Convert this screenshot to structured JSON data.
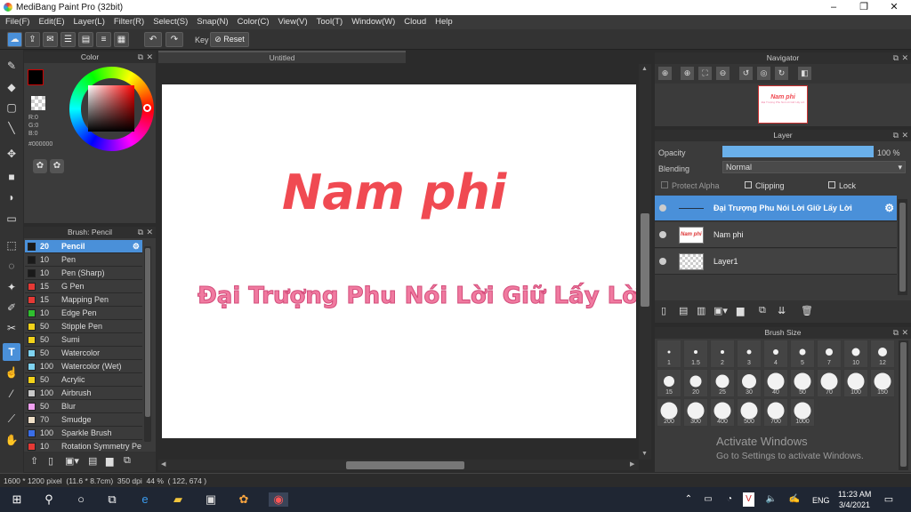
{
  "window": {
    "title": "MediBang Paint Pro (32bit)",
    "min": "–",
    "max": "❐",
    "close": "✕"
  },
  "menu": [
    "File(F)",
    "Edit(E)",
    "Layer(L)",
    "Filter(R)",
    "Select(S)",
    "Snap(N)",
    "Color(C)",
    "View(V)",
    "Tool(T)",
    "Window(W)",
    "Cloud",
    "Help"
  ],
  "toolbar": {
    "key_label": "Key",
    "reset_label": "Reset"
  },
  "color_panel": {
    "title": "Color",
    "r": "R:0",
    "g": "G:0",
    "b": "B:0",
    "hex": "#000000"
  },
  "brush_panel": {
    "title": "Brush: Pencil",
    "items": [
      {
        "size": "20",
        "name": "Pencil",
        "color": "#1a1a1a",
        "selected": true
      },
      {
        "size": "10",
        "name": "Pen",
        "color": "#1a1a1a"
      },
      {
        "size": "10",
        "name": "Pen (Sharp)",
        "color": "#1a1a1a"
      },
      {
        "size": "15",
        "name": "G Pen",
        "color": "#e53935"
      },
      {
        "size": "15",
        "name": "Mapping Pen",
        "color": "#e53935"
      },
      {
        "size": "10",
        "name": "Edge Pen",
        "color": "#2fbf2f"
      },
      {
        "size": "50",
        "name": "Stipple Pen",
        "color": "#f2d21a"
      },
      {
        "size": "50",
        "name": "Sumi",
        "color": "#f2d21a"
      },
      {
        "size": "50",
        "name": "Watercolor",
        "color": "#7fd3f0"
      },
      {
        "size": "100",
        "name": "Watercolor (Wet)",
        "color": "#7fd3f0"
      },
      {
        "size": "50",
        "name": "Acrylic",
        "color": "#f2d21a"
      },
      {
        "size": "100",
        "name": "Airbrush",
        "color": "#c8c8c8"
      },
      {
        "size": "50",
        "name": "Blur",
        "color": "#f0a0f0"
      },
      {
        "size": "70",
        "name": "Smudge",
        "color": "#f0e0c8"
      },
      {
        "size": "100",
        "name": "Sparkle Brush",
        "color": "#3a6ee8"
      },
      {
        "size": "10",
        "name": "Rotation Symmetry Pe",
        "color": "#e53935"
      }
    ]
  },
  "canvas": {
    "tab_title": "Untitled",
    "heading": "Nam phi",
    "subtext": "Đại Trượng Phu Nói Lời Giữ Lấy Lời",
    "heading_color": "#f04a52",
    "subtext_color": "#f07aa0"
  },
  "navigator": {
    "title": "Navigator",
    "thumb_heading": "Nam phi",
    "thumb_sub": "Đại Trượng Phu Nói Lời Giữ Lấy Lời"
  },
  "layer_panel": {
    "title": "Layer",
    "opacity_label": "Opacity",
    "opacity_value": "100 %",
    "blending_label": "Blending",
    "blending_value": "Normal",
    "protect_alpha": "Protect Alpha",
    "clipping": "Clipping",
    "lock": "Lock",
    "layers": [
      {
        "name": "Đại Trượng Phu Nói Lời Giữ Lấy Lời",
        "selected": true
      },
      {
        "name": "Nam phi",
        "thumb_text": "Nam phi"
      },
      {
        "name": "Layer1"
      }
    ]
  },
  "brush_size_panel": {
    "title": "Brush Size",
    "sizes": [
      "1",
      "1.5",
      "2",
      "3",
      "4",
      "5",
      "7",
      "10",
      "12",
      "15",
      "20",
      "25",
      "30",
      "40",
      "50",
      "70",
      "100",
      "150",
      "200",
      "300",
      "400",
      "500",
      "700",
      "1000"
    ]
  },
  "status": {
    "text": "1600 * 1200 pixel  (11.6 * 8.7cm)  350 dpi  44 %  ( 122, 674 )"
  },
  "watermark": {
    "line1": "Activate Windows",
    "line2": "Go to Settings to activate Windows."
  },
  "taskbar": {
    "lang": "ENG",
    "time": "11:23 AM",
    "date": "3/4/2021"
  },
  "colors": {
    "accent": "#4a90d9",
    "panel_bg": "#3b3b3b",
    "opacity_bar": "#6ab0ea"
  }
}
